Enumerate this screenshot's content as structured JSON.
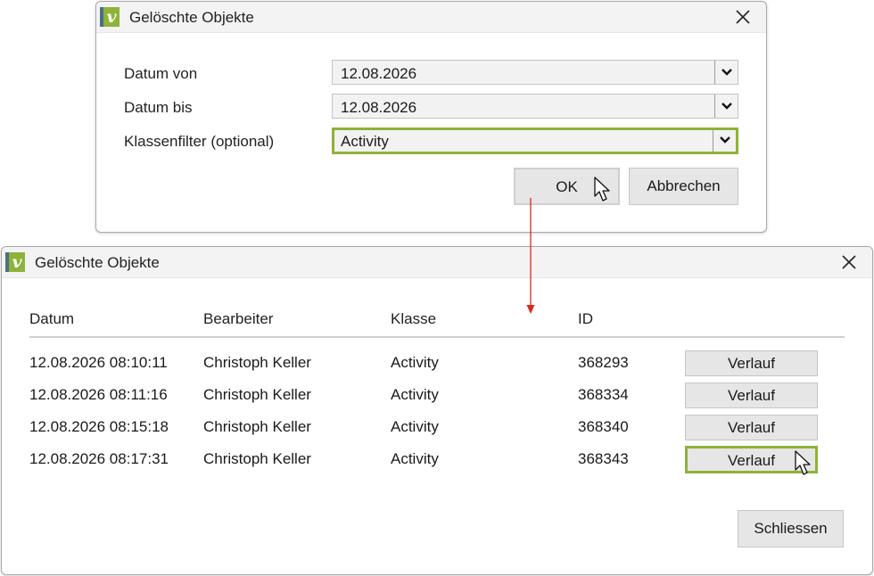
{
  "filter_dialog": {
    "title": "Gelöschte Objekte",
    "logo_letter": "v",
    "fields": [
      {
        "label": "Datum von",
        "value": "12.08.2026"
      },
      {
        "label": "Datum bis",
        "value": "12.08.2026"
      },
      {
        "label": "Klassenfilter (optional)",
        "value": "Activity"
      }
    ],
    "ok_label": "OK",
    "cancel_label": "Abbrechen"
  },
  "results_dialog": {
    "title": "Gelöschte Objekte",
    "logo_letter": "v",
    "columns": [
      "Datum",
      "Bearbeiter",
      "Klasse",
      "ID"
    ],
    "rows": [
      {
        "datum": "12.08.2026 08:10:11",
        "bearbeiter": "Christoph Keller",
        "klasse": "Activity",
        "id": "368293",
        "button": "Verlauf"
      },
      {
        "datum": "12.08.2026 08:11:16",
        "bearbeiter": "Christoph Keller",
        "klasse": "Activity",
        "id": "368334",
        "button": "Verlauf"
      },
      {
        "datum": "12.08.2026 08:15:18",
        "bearbeiter": "Christoph Keller",
        "klasse": "Activity",
        "id": "368340",
        "button": "Verlauf"
      },
      {
        "datum": "12.08.2026 08:17:31",
        "bearbeiter": "Christoph Keller",
        "klasse": "Activity",
        "id": "368343",
        "button": "Verlauf"
      }
    ],
    "close_label": "Schliessen"
  },
  "colors": {
    "accent_green": "#8db339",
    "logo_blue": "#4c6d8c",
    "annotation_arrow": "#d9281e"
  }
}
